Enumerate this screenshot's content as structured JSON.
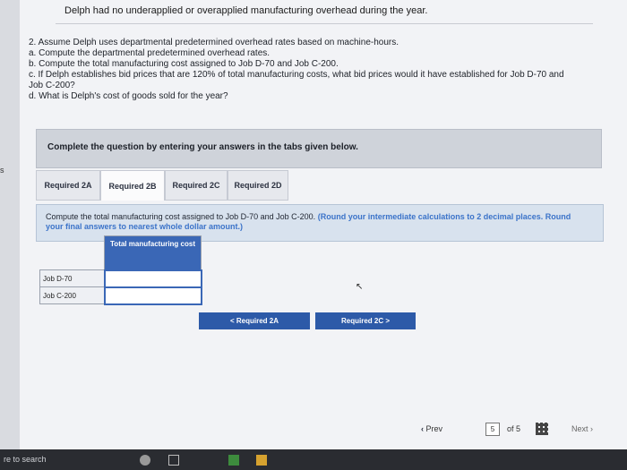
{
  "header": {
    "text": "Delph had no underapplied or overapplied manufacturing overhead during the year."
  },
  "left_strip_text": "s",
  "question": {
    "lines": [
      "2. Assume Delph uses departmental predetermined overhead rates based on machine-hours.",
      "a. Compute the departmental predetermined overhead rates.",
      "b. Compute the total manufacturing cost assigned to Job D-70 and Job C-200.",
      "c. If Delph establishes bid prices that are 120% of total manufacturing costs, what bid prices would it have established for Job D-70 and",
      "Job C-200?",
      "d. What is Delph's cost of goods sold for the year?"
    ]
  },
  "instruction": "Complete the question by entering your answers in the tabs given below.",
  "tabs": [
    {
      "label": "Required 2A",
      "active": false
    },
    {
      "label": "Required 2B",
      "active": true
    },
    {
      "label": "Required 2C",
      "active": false
    },
    {
      "label": "Required 2D",
      "active": false
    }
  ],
  "prompt": {
    "main": "Compute the total manufacturing cost assigned to Job D-70 and Job C-200.",
    "note": "(Round your intermediate calculations to 2 decimal places. Round your final answers to nearest whole dollar amount.)"
  },
  "table": {
    "header": "Total manufacturing cost",
    "rows": [
      {
        "label": "Job D-70",
        "value": ""
      },
      {
        "label": "Job C-200",
        "value": ""
      }
    ]
  },
  "buttons": {
    "prev_label": "< Required 2A",
    "next_label": "Required 2C >"
  },
  "navigation": {
    "prev_label": "Prev",
    "current_page": "5",
    "of_label": "of 5",
    "next_label": "Next"
  },
  "taskbar": {
    "search_text": "re to search"
  },
  "colors": {
    "accent": "#2d5aa8",
    "table_header": "#3a67b6",
    "note_blue": "#3b73c9"
  }
}
